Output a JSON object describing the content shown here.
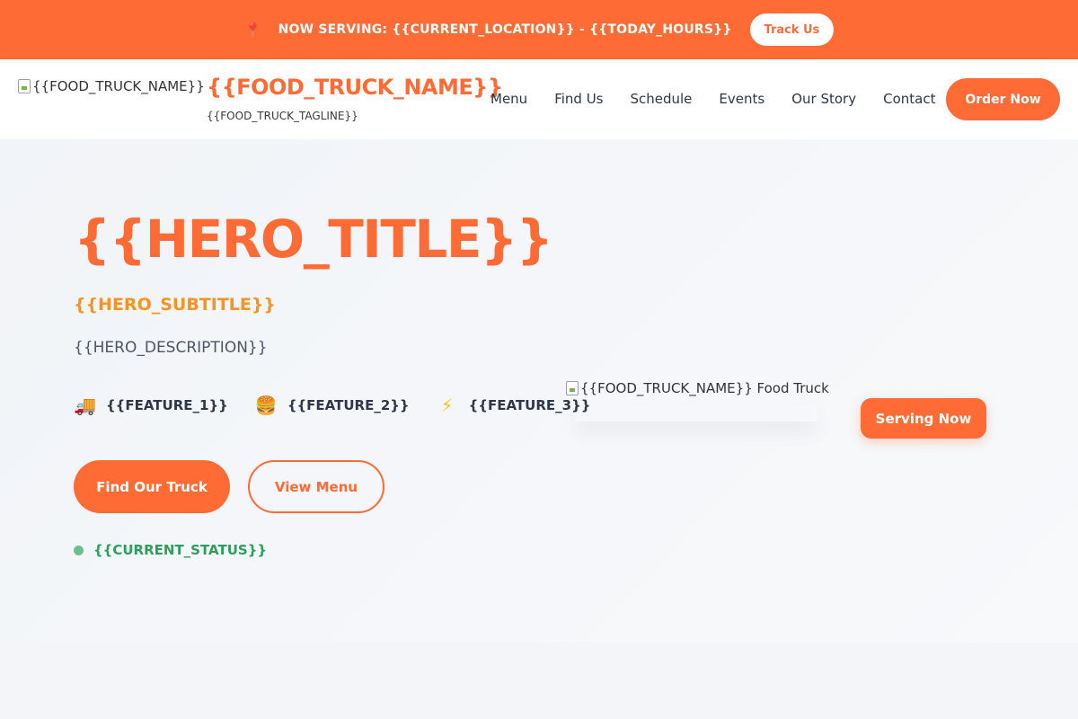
{
  "announcement": {
    "pin_icon": "map-pin-icon",
    "message": "NOW SERVING: {{CURRENT_LOCATION}} - {{TODAY_HOURS}}",
    "track_label": "Track Us"
  },
  "header": {
    "logo_alt": "{{FOOD_TRUCK_NAME}}",
    "brand_name": "{{FOOD_TRUCK_NAME}}",
    "tagline": "{{FOOD_TRUCK_TAGLINE}}",
    "nav": [
      "Menu",
      "Find Us",
      "Schedule",
      "Events",
      "Our Story",
      "Contact"
    ],
    "order_label": "Order Now"
  },
  "hero": {
    "title": "{{HERO_TITLE}}",
    "subtitle": "{{HERO_SUBTITLE}}",
    "description": "{{HERO_DESCRIPTION}}",
    "features": [
      {
        "icon": "truck-icon",
        "label": "{{FEATURE_1}}"
      },
      {
        "icon": "burger-icon",
        "label": "{{FEATURE_2}}"
      },
      {
        "icon": "lightning-icon",
        "label": "{{FEATURE_3}}"
      }
    ],
    "primary_button": "Find Our Truck",
    "secondary_button": "View Menu",
    "status": "{{CURRENT_STATUS}}",
    "image_alt": "{{FOOD_TRUCK_NAME}} Food Truck",
    "serving_badge": "Serving Now"
  },
  "colors": {
    "accent": "#ff6b35",
    "subtitle": "#f7931e",
    "status": "#2f9e5b"
  }
}
